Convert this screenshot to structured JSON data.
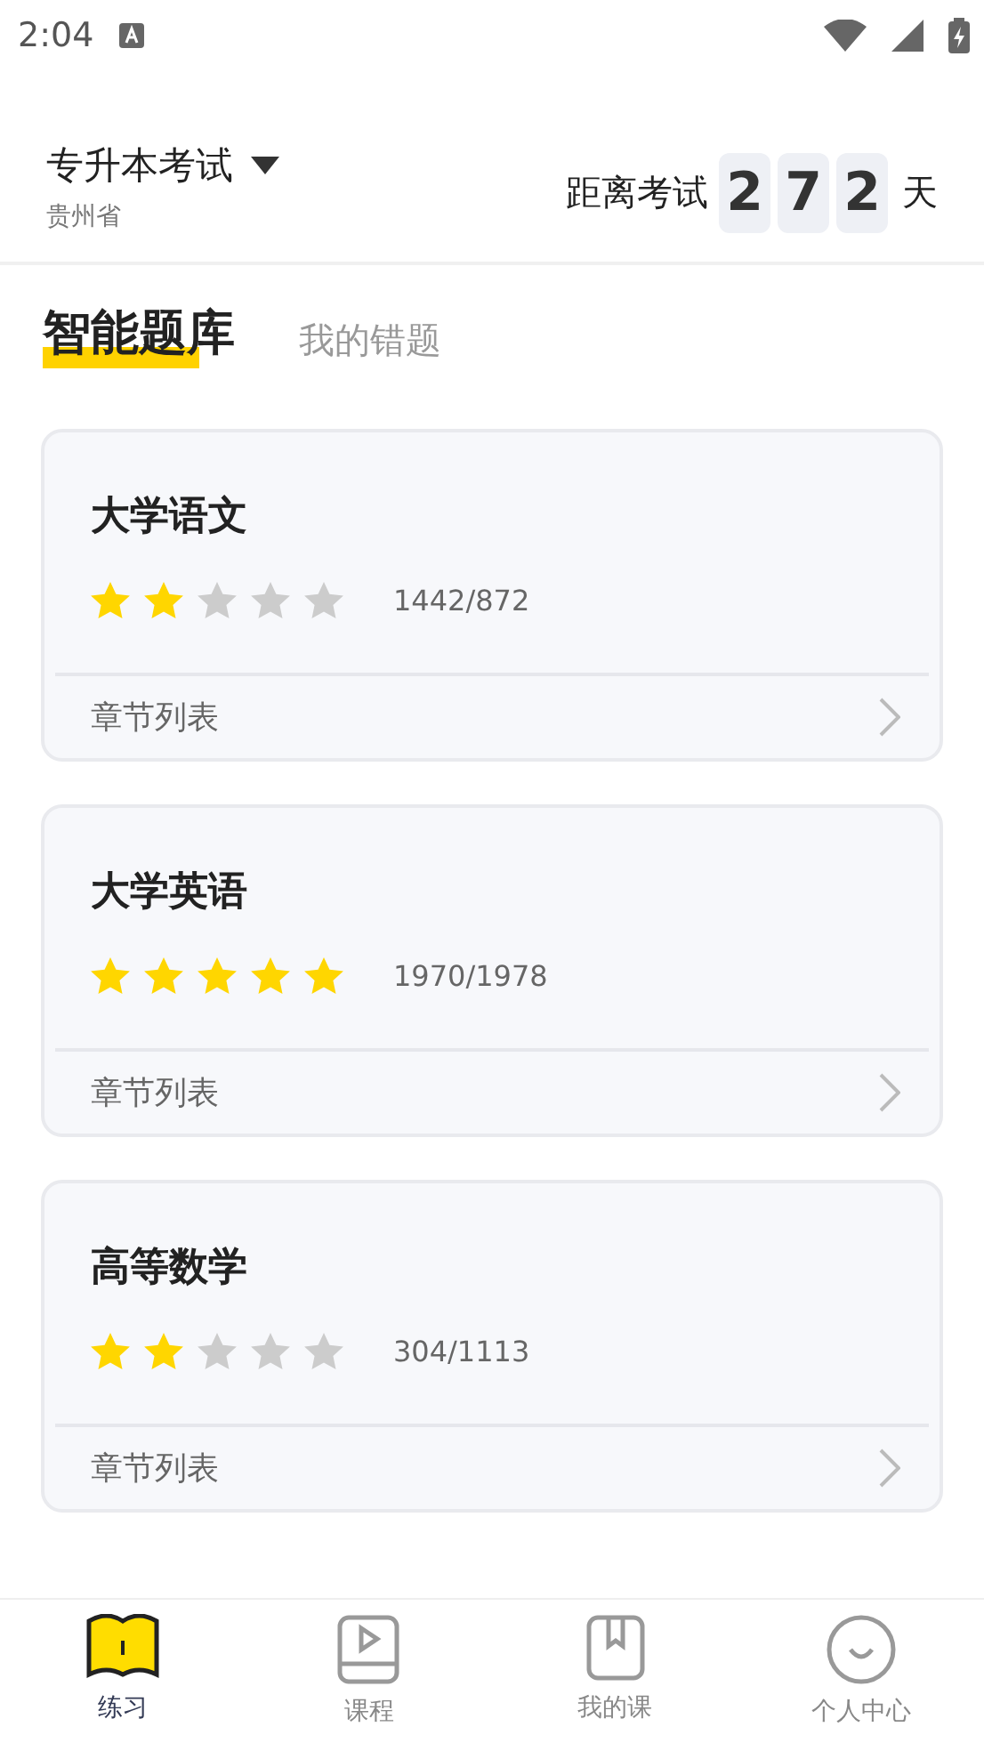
{
  "status_bar": {
    "time": "2:04"
  },
  "header": {
    "exam": "专升本考试",
    "region": "贵州省",
    "countdown_label": "距离考试",
    "digits": [
      "2",
      "7",
      "2"
    ],
    "unit": "天"
  },
  "tabs": [
    {
      "label": "智能题库",
      "selected": true
    },
    {
      "label": "我的错题",
      "selected": false
    }
  ],
  "subjects": [
    {
      "title": "大学语文",
      "stars": 2,
      "progress": "1442/872",
      "link": "章节列表"
    },
    {
      "title": "大学英语",
      "stars": 5,
      "progress": "1970/1978",
      "link": "章节列表"
    },
    {
      "title": "高等数学",
      "stars": 2,
      "progress": "304/1113",
      "link": "章节列表"
    }
  ],
  "nav": [
    {
      "label": "练习",
      "kind": "practice",
      "selected": true
    },
    {
      "label": "课程",
      "kind": "course",
      "selected": false
    },
    {
      "label": "我的课",
      "kind": "mycourse",
      "selected": false
    },
    {
      "label": "个人中心",
      "kind": "profile",
      "selected": false
    }
  ]
}
